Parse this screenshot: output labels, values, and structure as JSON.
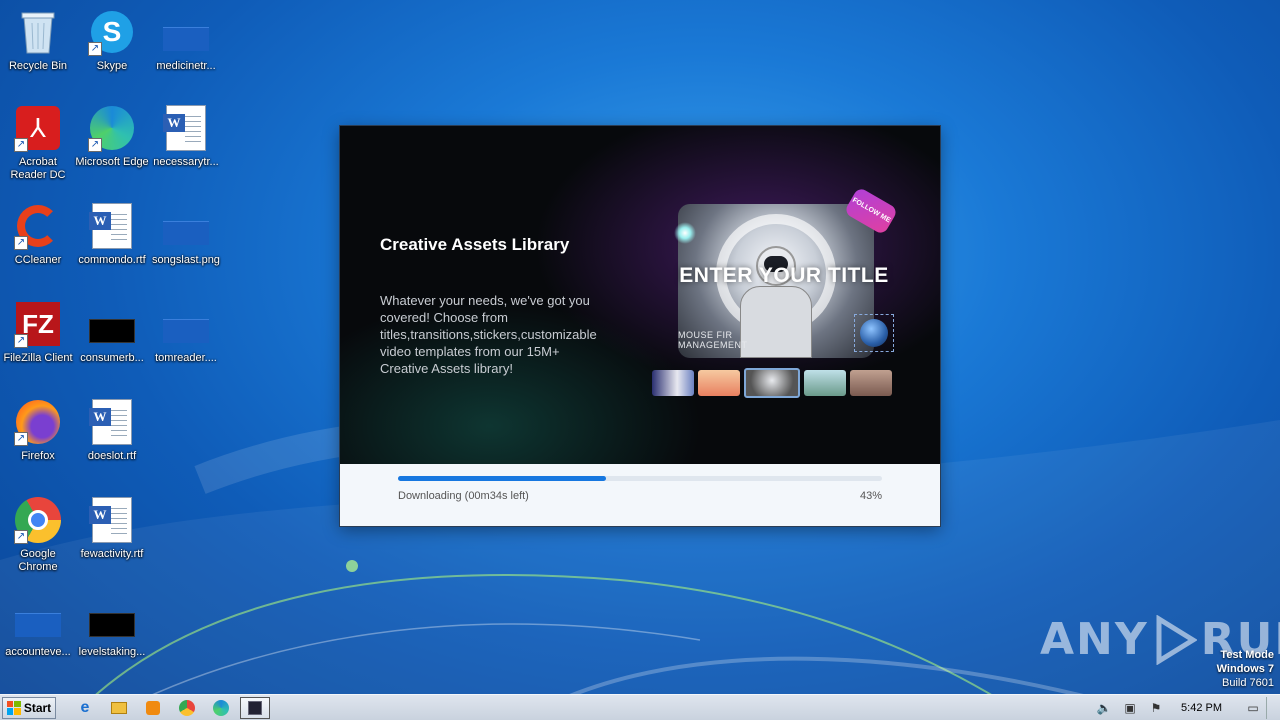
{
  "desktop": {
    "icons": [
      {
        "label": "Recycle Bin",
        "icon": "recycle-bin-icon"
      },
      {
        "label": "Skype",
        "icon": "skype-icon"
      },
      {
        "label": "medicinetr...",
        "icon": "blank-file-icon"
      },
      {
        "label": "Acrobat Reader DC",
        "icon": "acrobat-icon"
      },
      {
        "label": "Microsoft Edge",
        "icon": "edge-icon"
      },
      {
        "label": "necessarytr...",
        "icon": "word-doc-icon"
      },
      {
        "label": "CCleaner",
        "icon": "ccleaner-icon"
      },
      {
        "label": "commondo.rtf",
        "icon": "word-doc-icon"
      },
      {
        "label": "songslast.png",
        "icon": "blank-file-icon"
      },
      {
        "label": "FileZilla Client",
        "icon": "filezilla-icon"
      },
      {
        "label": "consumerb...",
        "icon": "black-thumb-icon"
      },
      {
        "label": "tomreader....",
        "icon": "blank-file-icon"
      },
      {
        "label": "Firefox",
        "icon": "firefox-icon"
      },
      {
        "label": "doeslot.rtf",
        "icon": "word-doc-icon"
      },
      {
        "label": "Google Chrome",
        "icon": "chrome-icon"
      },
      {
        "label": "fewactivity.rtf",
        "icon": "word-doc-icon"
      },
      {
        "label": "accounteve...",
        "icon": "blank-file-icon"
      },
      {
        "label": "levelstaking...",
        "icon": "black-thumb-icon"
      }
    ]
  },
  "installer": {
    "title": "Creative Assets Library",
    "description": "Whatever your needs, we've got you covered! Choose from titles,transitions,stickers,customizable video templates from our 15M+ Creative Assets library!",
    "preview_title": "ENTER YOUR TITLE",
    "preview_subtitle": "MOUSE FIR MANAGEMENT",
    "badge": "FOLLOW ME",
    "progress_label": "Downloading (00m34s left)",
    "progress_percent_text": "43%",
    "progress_value": 0.43,
    "accent_color": "#1677e0"
  },
  "watermark": {
    "text_left": "ANY",
    "text_right": "RUN"
  },
  "os_info": {
    "line1": "Test Mode",
    "line2": "Windows 7",
    "line3": "Build 7601"
  },
  "taskbar": {
    "start_label": "Start",
    "pinned": [
      "ie-icon",
      "explorer-icon",
      "media-player-icon",
      "chrome-icon",
      "edge-icon",
      "installer-icon"
    ],
    "clock": "5:42 PM"
  }
}
